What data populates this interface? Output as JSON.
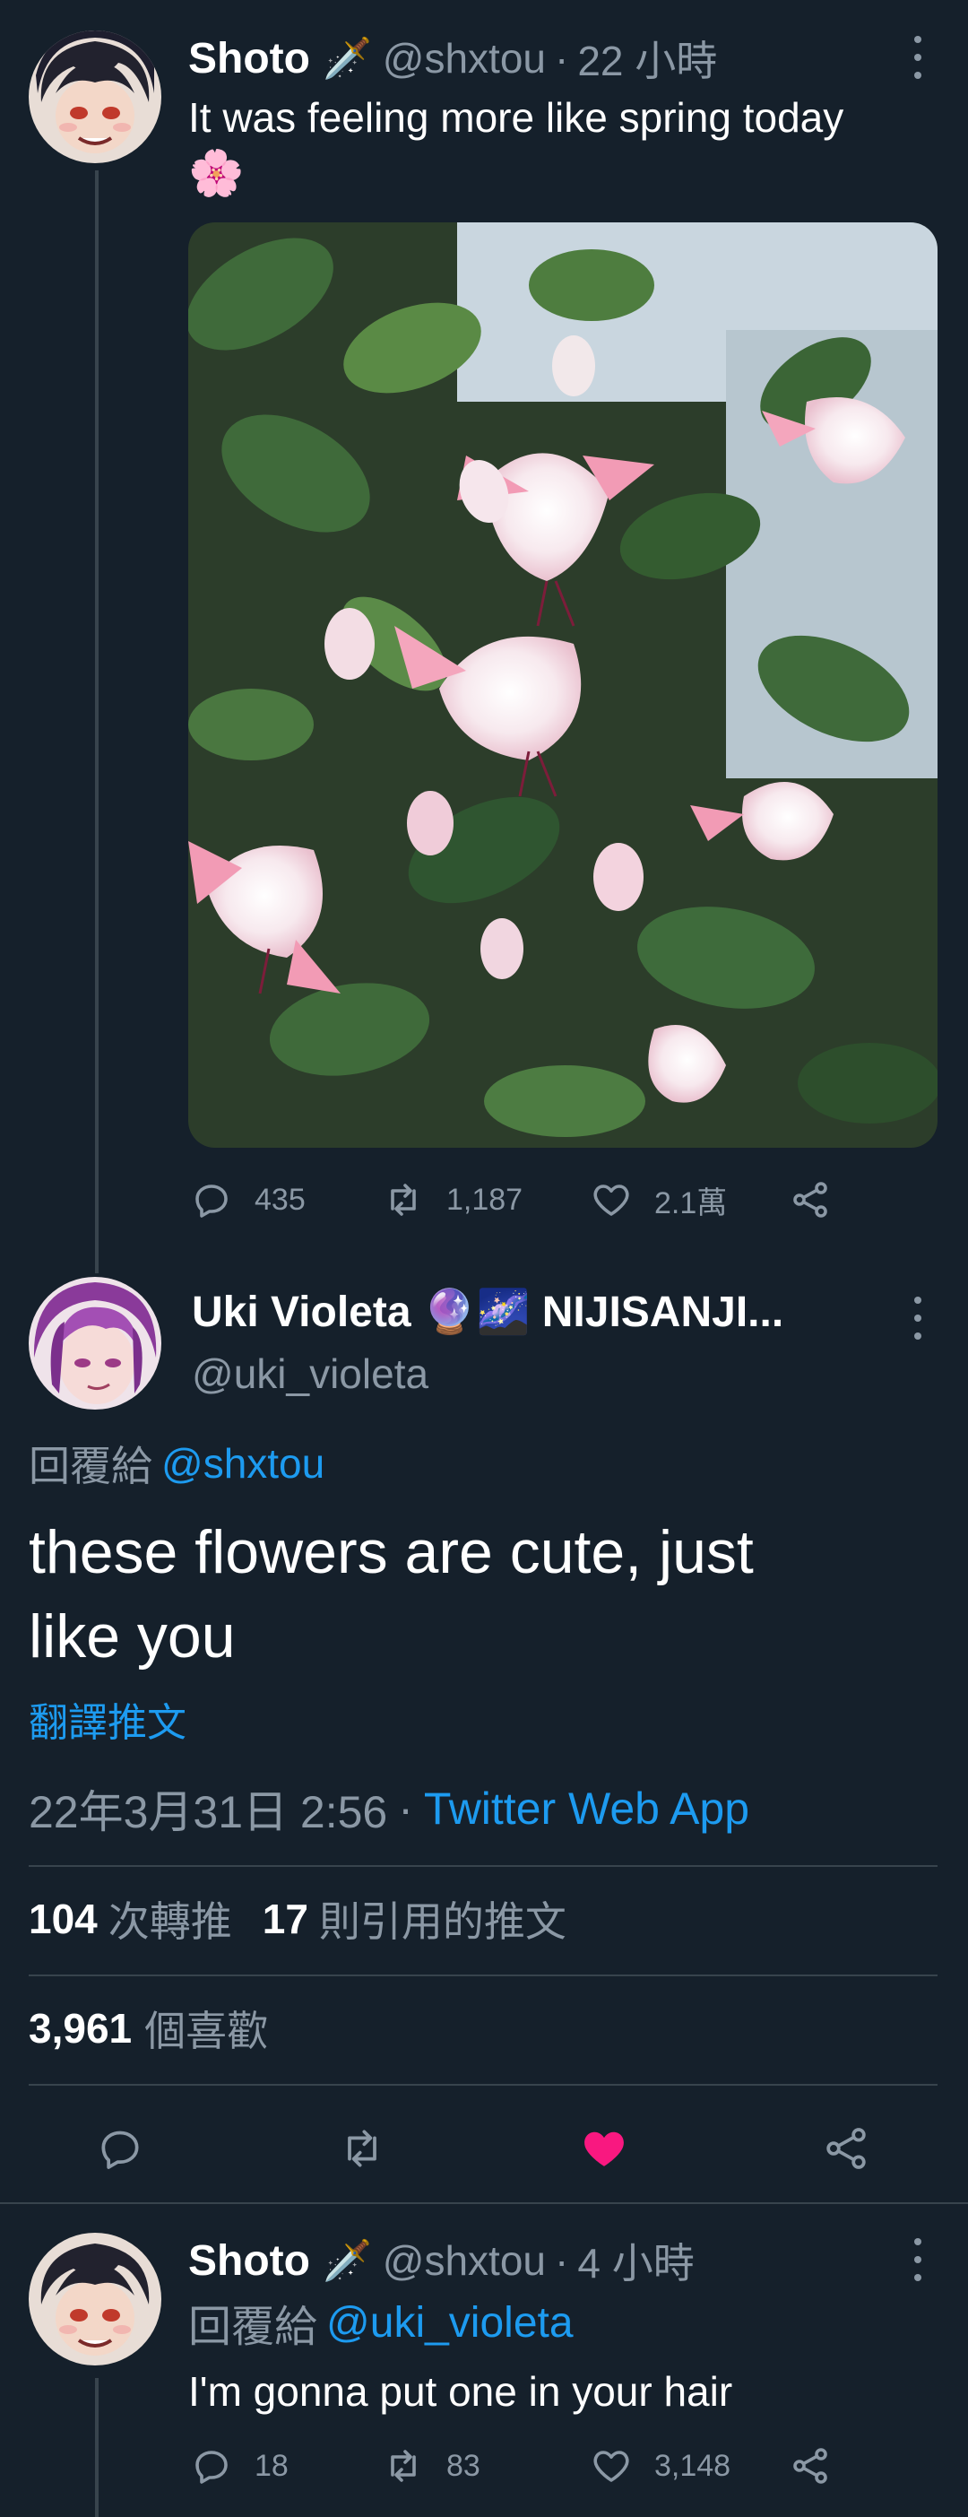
{
  "tweet1": {
    "display_name": "Shoto",
    "emoji": "🗡️",
    "handle": "@shxtou",
    "time": "22 小時",
    "text_line1": "It was feeling more like spring today",
    "text_emoji": "🌸",
    "reply_count": "435",
    "retweet_count": "1,187",
    "like_count": "2.1萬"
  },
  "tweet2": {
    "display_name": "Uki Violeta 🔮🌌 NIJISANJI...",
    "handle": "@uki_violeta",
    "reply_prefix": "回覆給",
    "reply_to": "@shxtou",
    "text_line1": "these flowers are cute, just",
    "text_line2": "like you",
    "translate": "翻譯推文",
    "timestamp": "22年3月31日 2:56",
    "separator": "·",
    "source": "Twitter Web App",
    "retweets_num": "104",
    "retweets_label": "次轉推",
    "quotes_num": "17",
    "quotes_label": "則引用的推文",
    "likes_num": "3,961",
    "likes_label": "個喜歡"
  },
  "tweet3": {
    "display_name": "Shoto",
    "emoji": "🗡️",
    "handle": "@shxtou",
    "time": "4 小時",
    "reply_prefix": "回覆給",
    "reply_to": "@uki_violeta",
    "text": "I'm gonna put one in your hair",
    "reply_count": "18",
    "retweet_count": "83",
    "like_count": "3,148"
  },
  "common": {
    "dot": "·"
  },
  "colors": {
    "background": "#15202b",
    "secondary_text": "#8b98a5",
    "link": "#1d9bf0",
    "like_active": "#f91880",
    "divider": "#38444d"
  },
  "icons": [
    "reply-icon",
    "retweet-icon",
    "like-icon",
    "share-icon",
    "more-icon"
  ]
}
